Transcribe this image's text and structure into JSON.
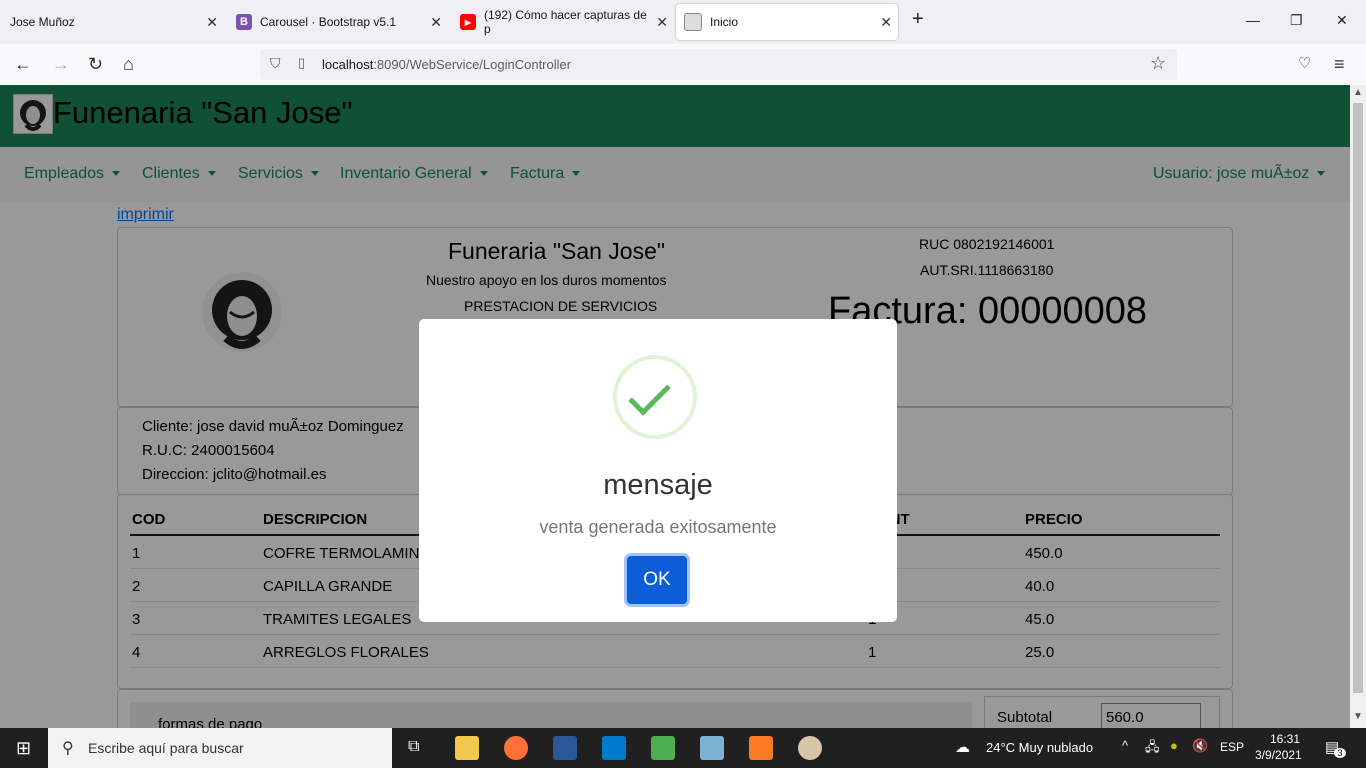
{
  "browser": {
    "tabs": [
      {
        "title": "Jose Muñoz"
      },
      {
        "title": "Carousel · Bootstrap v5.1",
        "icon": "B"
      },
      {
        "title": "(192) Cómo hacer capturas de p"
      },
      {
        "title": "Inicio"
      }
    ],
    "url_host": "localhost",
    "url_rest": ":8090/WebService/LoginController"
  },
  "site": {
    "brand": "Funenaria \"San Jose\"",
    "menu": [
      "Empleados",
      "Clientes",
      "Servicios",
      "Inventario General",
      "Factura"
    ],
    "user_menu": "Usuario: jose muÃ±oz"
  },
  "invoice": {
    "print_link": "imprimir",
    "company": "Funeraria \"San Jose\"",
    "slogan": "Nuestro apoyo en los duros momentos",
    "service": "PRESTACION DE SERVICIOS",
    "ruc": "RUC 0802192146001",
    "aut": "AUT.SRI.1118663180",
    "number": "Factura: 00000008",
    "client": "Cliente: jose david muÃ±oz Dominguez",
    "client_ruc": "R.U.C: 2400015604",
    "client_address": "Direccion: jclito@hotmail.es",
    "headers": {
      "cod": "COD",
      "desc": "DESCRIPCION",
      "cant": "CANT",
      "price": "PRECIO"
    },
    "rows": [
      {
        "cod": "1",
        "desc": "COFRE TERMOLAMINADO",
        "cant": "1",
        "price": "450.0"
      },
      {
        "cod": "2",
        "desc": "CAPILLA GRANDE",
        "cant": "1",
        "price": "40.0"
      },
      {
        "cod": "3",
        "desc": "TRAMITES LEGALES",
        "cant": "1",
        "price": "45.0"
      },
      {
        "cod": "4",
        "desc": "ARREGLOS FLORALES",
        "cant": "1",
        "price": "25.0"
      }
    ],
    "payment_label": "formas de pago",
    "subtotal_label": "Subtotal",
    "subtotal_value": "560.0"
  },
  "modal": {
    "title": "mensaje",
    "text": "venta generada exitosamente",
    "ok": "OK"
  },
  "taskbar": {
    "search_placeholder": "Escribe aquí para buscar",
    "weather": "24°C  Muy nublado",
    "lang": "ESP",
    "time": "16:31",
    "date": "3/9/2021",
    "notif_count": "3"
  },
  "colors": {
    "header": "#198754",
    "menu_link": "#198754",
    "ok_button": "#0b5ed7",
    "check": "#5cb85c"
  }
}
